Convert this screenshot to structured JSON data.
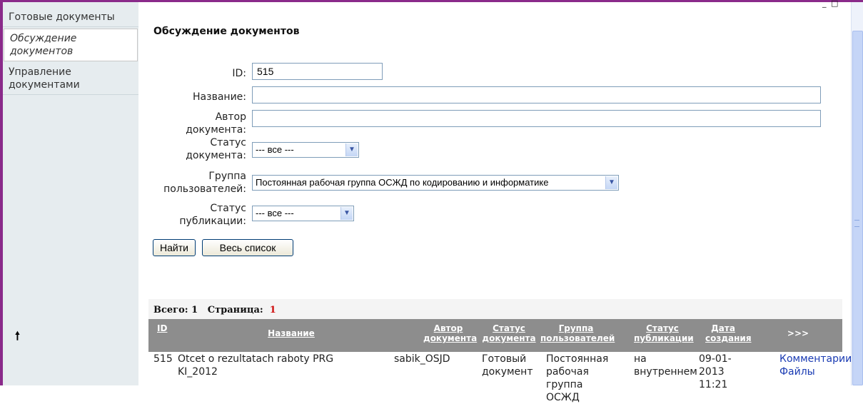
{
  "window": {
    "minimize": "_",
    "maximize": "□"
  },
  "sidebar": {
    "items": [
      {
        "label": "Готовые документы"
      },
      {
        "label": "Обсуждение документов"
      },
      {
        "label": "Управление документами"
      }
    ]
  },
  "page": {
    "title": "Обсуждение документов"
  },
  "form": {
    "id_label": "ID:",
    "id_value": "515",
    "name_label": "Название:",
    "name_value": "",
    "author_label": "Автор документа:",
    "author_value": "",
    "doc_status_label": "Статус документа:",
    "doc_status_value": "--- все ---",
    "group_label": "Группа пользователей:",
    "group_value": "Постоянная рабочая группа ОСЖД по кодированию и информатике",
    "pub_status_label": "Статус публикации:",
    "pub_status_value": "--- все ---",
    "find_button": "Найти",
    "all_button": "Весь список"
  },
  "results": {
    "total_label": "Всего: 1",
    "page_label": "Страница:",
    "page_number": "1",
    "columns": {
      "id": "ID",
      "name": "Название",
      "author": "Автор документа",
      "doc_status": "Статус документа",
      "group": "Группа пользователей",
      "pub_status": "Статус публикации",
      "created": "Дата создания",
      "more": ">>>"
    },
    "row": {
      "id": "515",
      "name": "Otcet o rezultatach raboty PRG KI_2012",
      "author": "sabik_OSJD",
      "doc_status": "Готовый документ",
      "group": "Постоянная рабочая группа ОСЖД",
      "pub_status": "на внутреннем",
      "created": "09-01- 2013 11:21",
      "comments_link": "Комментарии",
      "files_link": "Файлы"
    }
  }
}
